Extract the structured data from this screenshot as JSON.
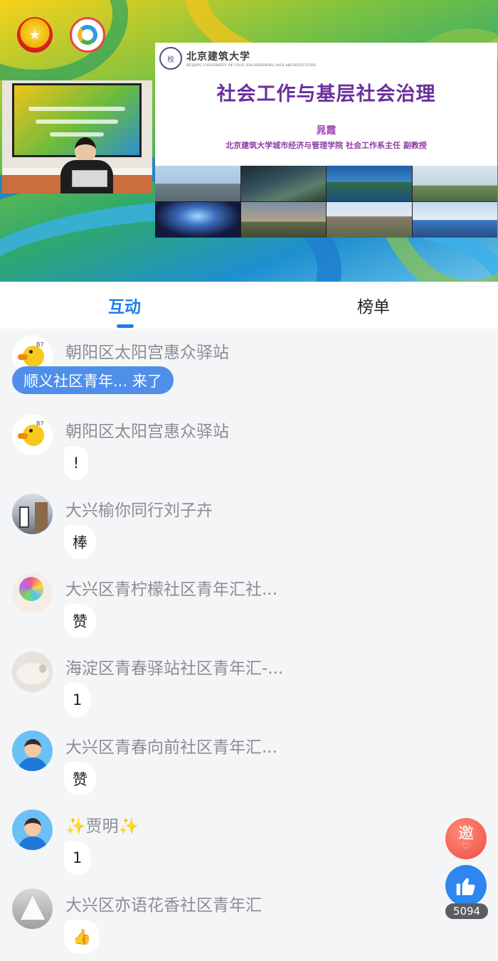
{
  "video": {
    "slide": {
      "university_name": "北京建筑大学",
      "university_en": "BEIJING UNIVERSITY OF CIVIL ENGINEERING AND ARCHITECTURE",
      "title": "社会工作与基层社会治理",
      "speaker": "晁霞",
      "affiliation": "北京建筑大学城市经济与管理学院 社会工作系主任 副教授"
    }
  },
  "tabs": [
    {
      "label": "互动",
      "active": true
    },
    {
      "label": "榜单",
      "active": false
    }
  ],
  "toast": "顺义社区青年... 来了",
  "messages": [
    {
      "user": "朝阳区太阳宫惠众驿站",
      "text": "",
      "avatar": "duck-avatar"
    },
    {
      "user": "朝阳区太阳宫惠众驿站",
      "text": "!",
      "avatar": "duck-avatar"
    },
    {
      "user": "大兴榆你同行刘子卉",
      "text": "棒",
      "avatar": "building-photo-avatar"
    },
    {
      "user": "大兴区青柠檬社区青年汇社...",
      "text": "赞",
      "avatar": "lollipop-avatar"
    },
    {
      "user": "海淀区青春驿站社区青年汇-...",
      "text": "1",
      "avatar": "cat-avatar"
    },
    {
      "user": "大兴区青春向前社区青年汇...",
      "text": "赞",
      "avatar": "default-boy-avatar"
    },
    {
      "user": "✨贾明✨",
      "text": "1",
      "avatar": "default-boy-avatar"
    },
    {
      "user": "大兴区亦语花香社区青年汇",
      "text": "👍",
      "avatar": "tent-avatar"
    }
  ],
  "invite_label": "邀",
  "like_count": "5094",
  "colors": {
    "accent": "#1e7ee8",
    "toast": "#4f8fea",
    "slide_title": "#6b2f9e",
    "invite": "#ef4a45"
  }
}
